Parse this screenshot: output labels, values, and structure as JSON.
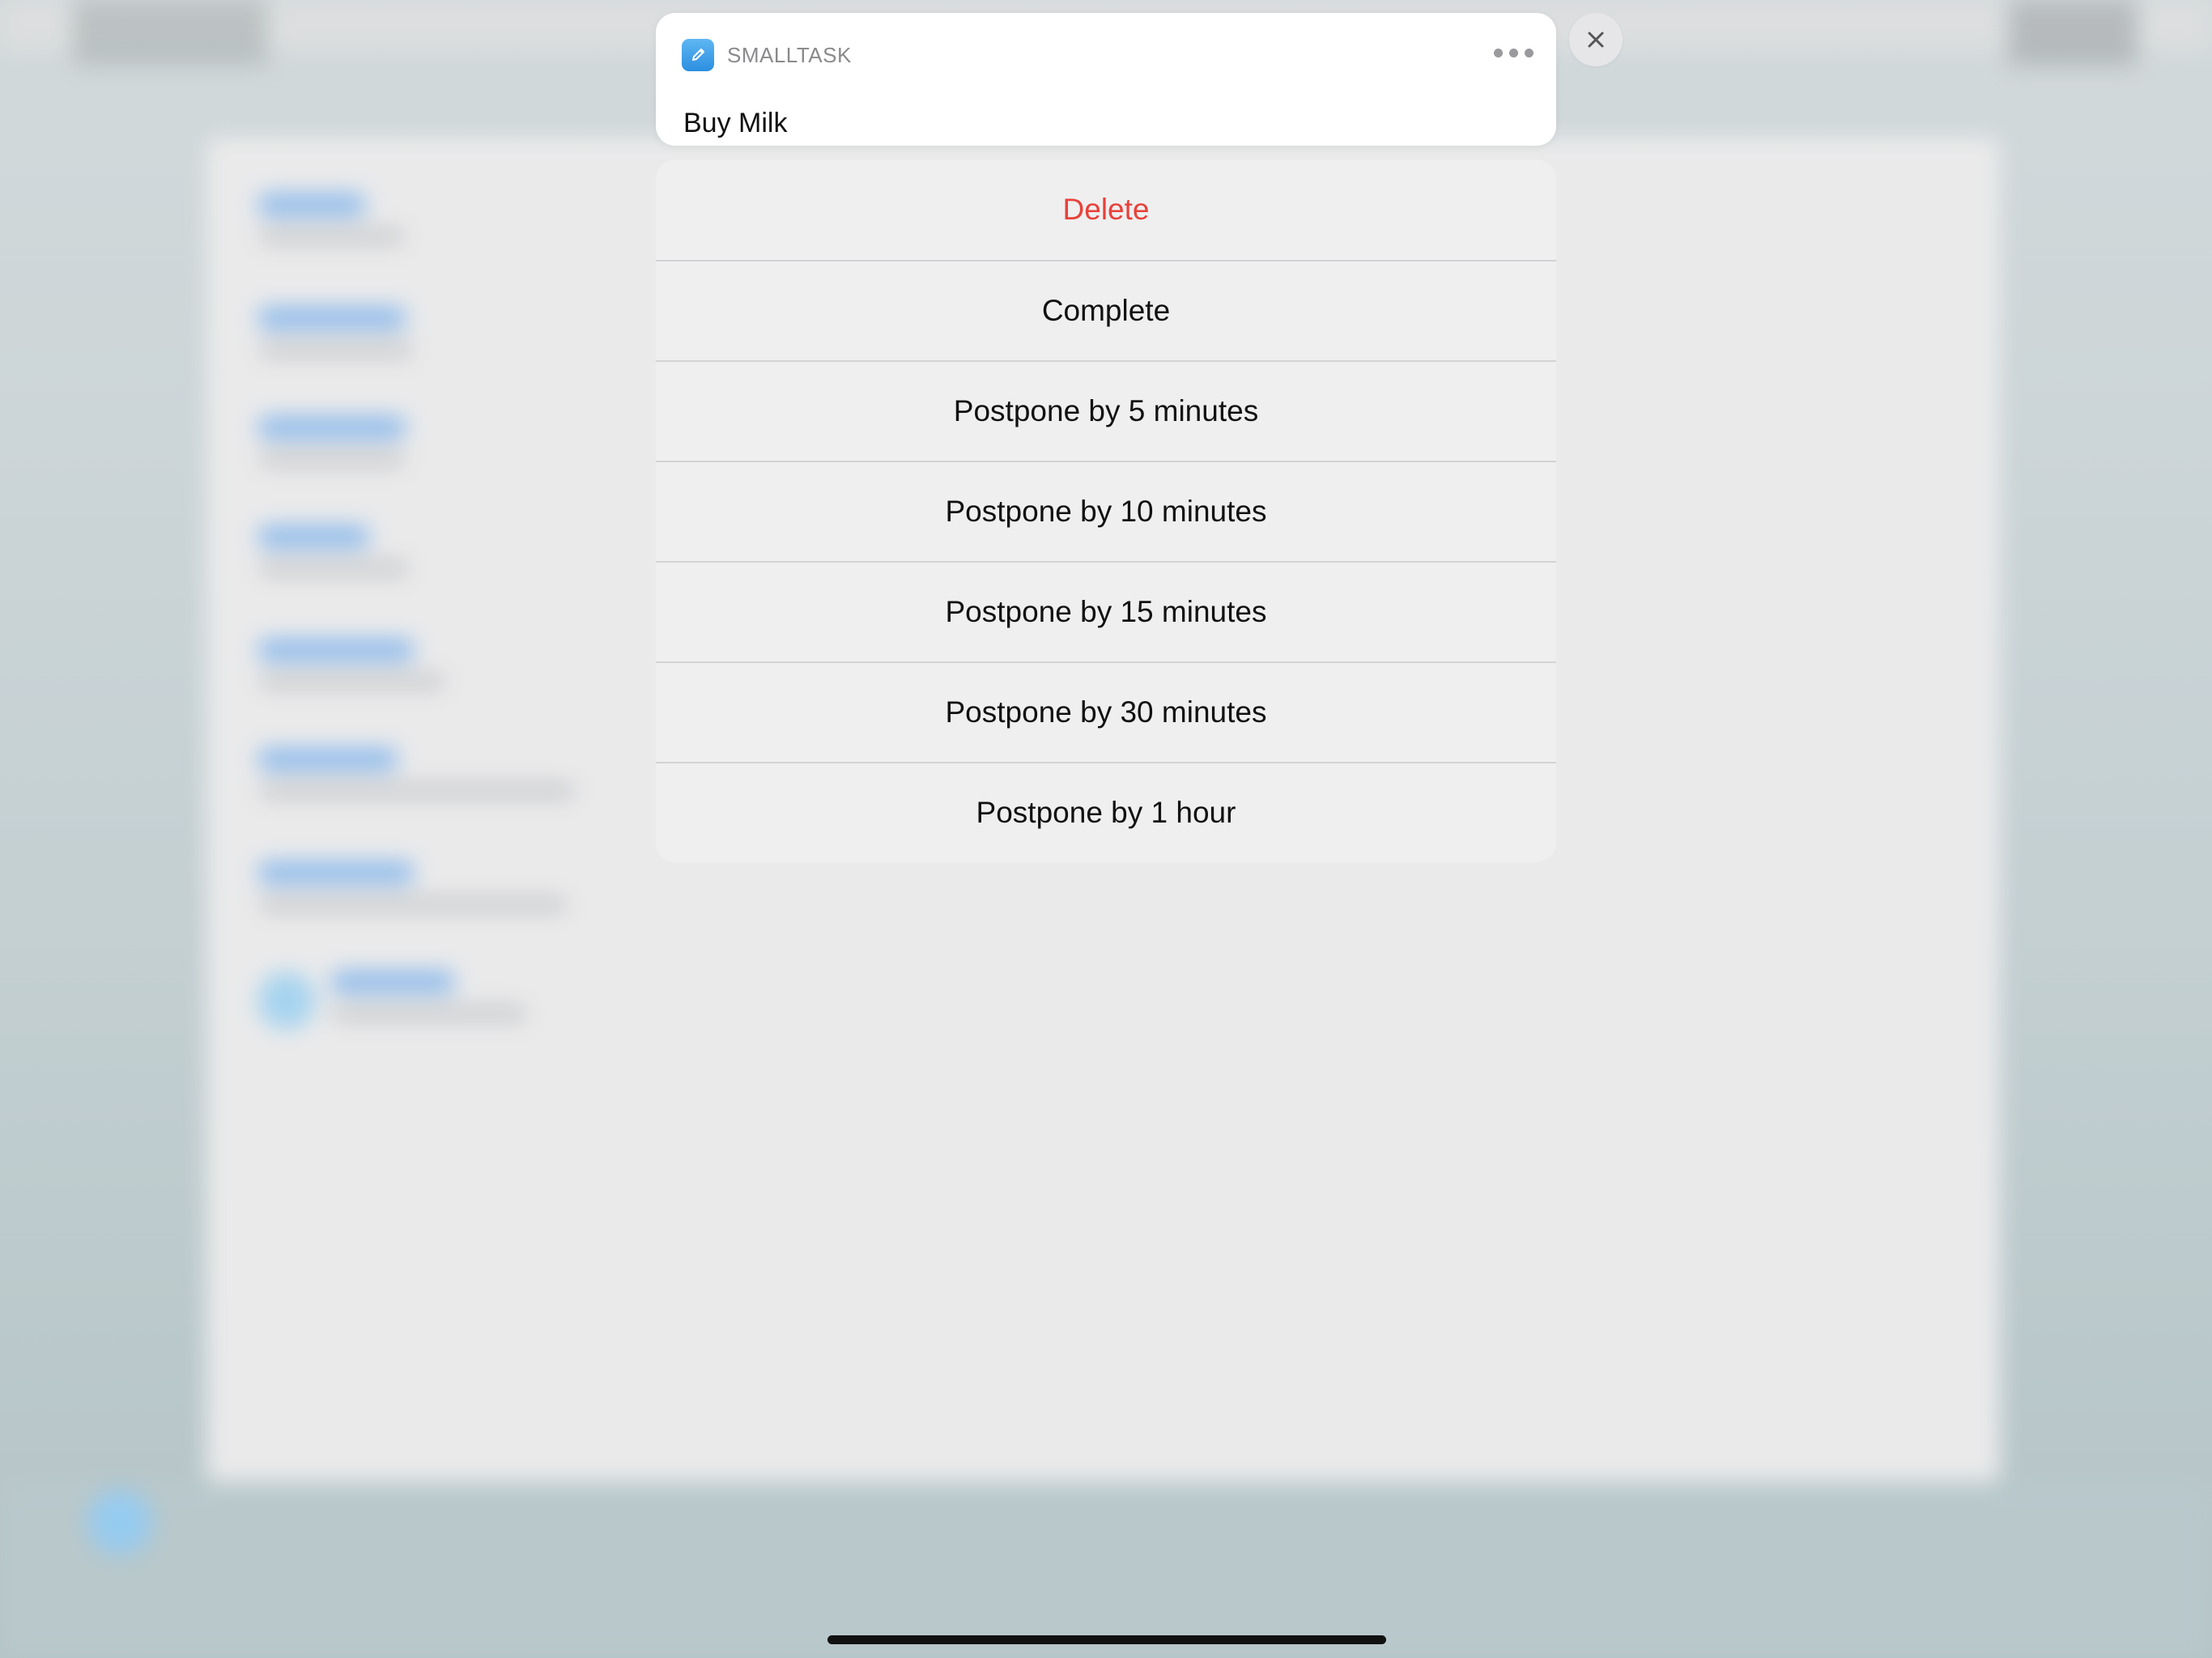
{
  "notification": {
    "app_name": "SMALLTASK",
    "title": "Buy Milk",
    "app_icon": "pencil-icon",
    "more_icon": "more-dots-icon"
  },
  "close": {
    "icon": "close-icon"
  },
  "actions": [
    {
      "label": "Delete",
      "style": "destructive"
    },
    {
      "label": "Complete",
      "style": "default"
    },
    {
      "label": "Postpone by 5 minutes",
      "style": "default"
    },
    {
      "label": "Postpone by 10 minutes",
      "style": "default"
    },
    {
      "label": "Postpone by 15 minutes",
      "style": "default"
    },
    {
      "label": "Postpone by 30 minutes",
      "style": "default"
    },
    {
      "label": "Postpone by 1 hour",
      "style": "default"
    }
  ],
  "colors": {
    "destructive": "#e8413a",
    "accent": "#2c8fe0"
  }
}
